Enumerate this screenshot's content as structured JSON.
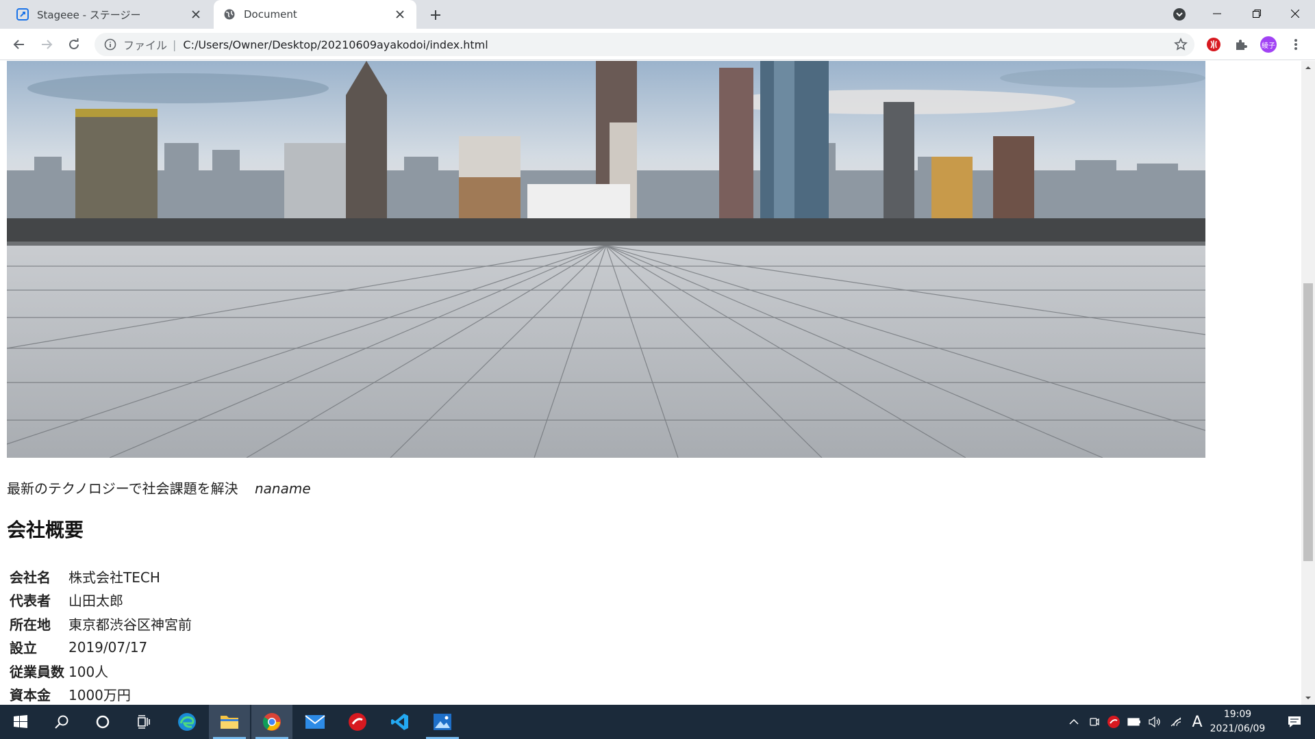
{
  "browser": {
    "tabs": [
      {
        "title": "Stageee - ステージー",
        "active": false
      },
      {
        "title": "Document",
        "active": true
      }
    ],
    "address": {
      "scheme_label": "ファイル",
      "separator": "|",
      "url": "C:/Users/Owner/Desktop/20210609ayakodoi/index.html"
    },
    "profile_initials": "綾子"
  },
  "page": {
    "tagline": "最新のテクノロジーで社会課題を解決",
    "brand": "naname",
    "section_title": "会社概要",
    "company_info": [
      {
        "label": "会社名",
        "value": "株式会社TECH"
      },
      {
        "label": "代表者",
        "value": "山田太郎"
      },
      {
        "label": "所在地",
        "value": "東京都渋谷区神宮前"
      },
      {
        "label": "設立",
        "value": "2019/07/17"
      },
      {
        "label": "従業員数",
        "value": "100人"
      },
      {
        "label": "資本金",
        "value": "1000万円"
      }
    ]
  },
  "taskbar": {
    "input_indicator": "A",
    "time": "19:09",
    "date": "2021/06/09"
  },
  "colors": {
    "tabstrip": "#dee1e6",
    "taskbar": "#1b2a3a",
    "profile": "#a142f4"
  }
}
